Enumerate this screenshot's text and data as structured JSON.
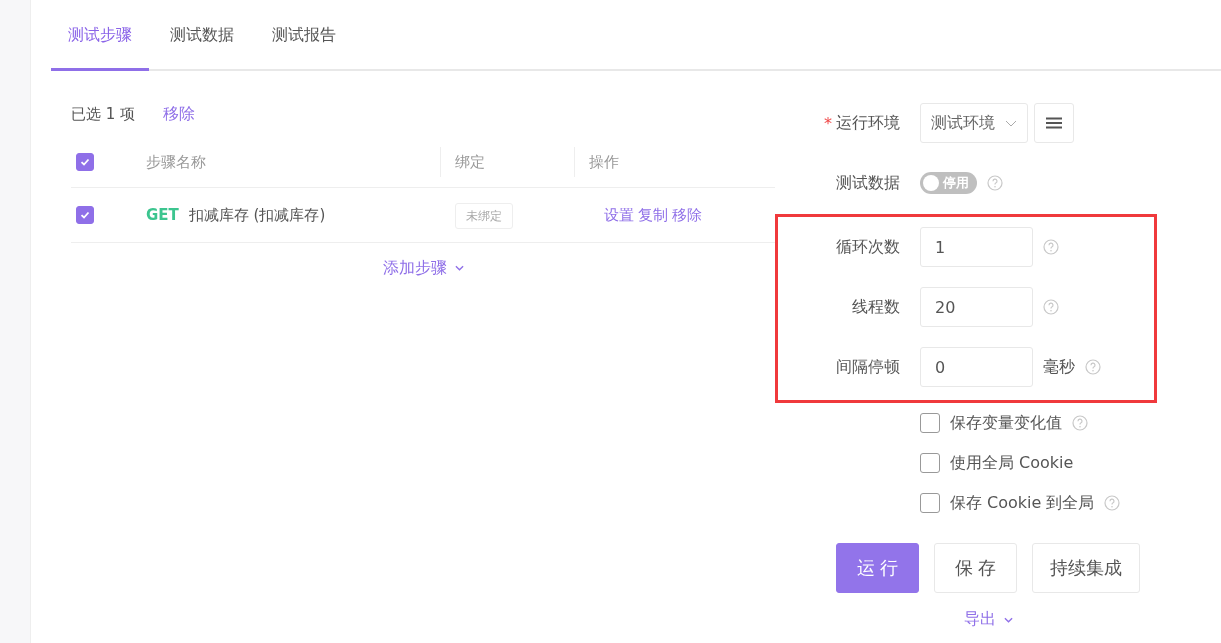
{
  "tabs": [
    {
      "label": "测试步骤",
      "selected": true
    },
    {
      "label": "测试数据",
      "selected": false
    },
    {
      "label": "测试报告",
      "selected": false
    }
  ],
  "selection": {
    "text": "已选 1 项",
    "remove": "移除"
  },
  "table": {
    "all_checked": true,
    "columns": [
      "步骤名称",
      "绑定",
      "操作"
    ],
    "rows": [
      {
        "checked": true,
        "method": "GET",
        "name": "扣减库存 (扣减库存)",
        "binding": "未绑定",
        "actions": [
          "设置",
          "复制",
          "移除"
        ]
      }
    ]
  },
  "add_step": "添加步骤",
  "environment": {
    "required_mark": "*",
    "label": "运行环境",
    "value": "测试环境"
  },
  "test_data": {
    "label": "测试数据",
    "on": false,
    "toggle_text": "停用",
    "help": true
  },
  "highlighted_fields": [
    {
      "label": "循环次数",
      "value": "1",
      "help": true
    },
    {
      "label": "线程数",
      "value": "20",
      "help": true
    },
    {
      "label": "间隔停顿",
      "value": "0",
      "unit": "毫秒",
      "help": true
    }
  ],
  "options": [
    {
      "label": "保存变量变化值",
      "checked": false,
      "help": true
    },
    {
      "label": "使用全局 Cookie",
      "checked": false,
      "help": false
    },
    {
      "label": "保存 Cookie 到全局",
      "checked": false,
      "help": true
    }
  ],
  "buttons": [
    {
      "label": "运 行",
      "kind": "primary"
    },
    {
      "label": "保 存",
      "kind": "default"
    },
    {
      "label": "持续集成",
      "kind": "default"
    }
  ],
  "export": "导出"
}
